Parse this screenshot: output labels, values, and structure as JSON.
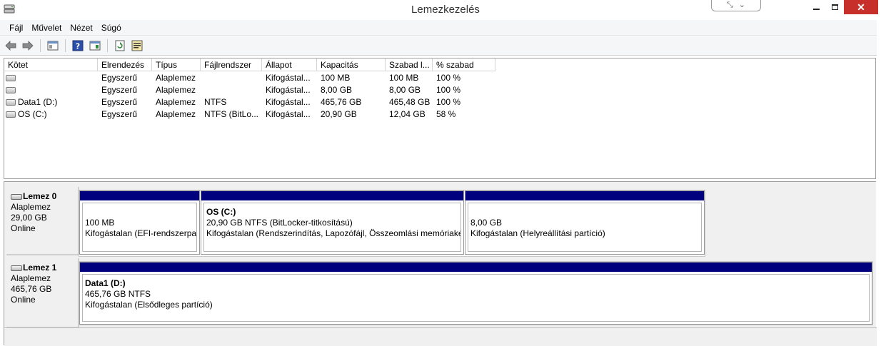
{
  "window": {
    "title": "Lemezkezelés",
    "close_glyph": "✕",
    "snap_glyphs": [
      "⤡",
      "⌄"
    ]
  },
  "menu": [
    "Fájl",
    "Művelet",
    "Nézet",
    "Súgó"
  ],
  "toolbar": {
    "icons": [
      "back-arrow-icon",
      "forward-arrow-icon",
      "show-hide-console-tree-icon",
      "help-icon",
      "show-hide-action-pane-icon",
      "refresh-icon",
      "properties-icon"
    ]
  },
  "volume_list": {
    "columns": [
      "Kötet",
      "Elrendezés",
      "Típus",
      "Fájlrendszer",
      "Állapot",
      "Kapacitás",
      "Szabad l...",
      "% szabad"
    ],
    "rows": [
      [
        "",
        "Egyszerű",
        "Alaplemez",
        "",
        "Kifogástal...",
        "100 MB",
        "100 MB",
        "100 %"
      ],
      [
        "",
        "Egyszerű",
        "Alaplemez",
        "",
        "Kifogástal...",
        "8,00 GB",
        "8,00 GB",
        "100 %"
      ],
      [
        "Data1 (D:)",
        "Egyszerű",
        "Alaplemez",
        "NTFS",
        "Kifogástal...",
        "465,76 GB",
        "465,48 GB",
        "100 %"
      ],
      [
        "OS (C:)",
        "Egyszerű",
        "Alaplemez",
        "NTFS (BitLo...",
        "Kifogástal...",
        "20,90 GB",
        "12,04 GB",
        "58 %"
      ]
    ]
  },
  "disks": [
    {
      "name": "Lemez 0",
      "type": "Alaplemez",
      "size": "29,00 GB",
      "status": "Online",
      "partitions": [
        {
          "name": "",
          "line1": "100 MB",
          "line2": "Kifogástalan (EFI-rendszerpart"
        },
        {
          "name": "OS  (C:)",
          "line1": "20,90 GB NTFS (BitLocker-titkosítású)",
          "line2": "Kifogástalan (Rendszerindítás, Lapozófájl, Összeomlási memóriakép"
        },
        {
          "name": "",
          "line1": "8,00 GB",
          "line2": "Kifogástalan (Helyreállítási partíció)"
        }
      ]
    },
    {
      "name": "Lemez 1",
      "type": "Alaplemez",
      "size": "465,76 GB",
      "status": "Online",
      "partitions": [
        {
          "name": "Data1  (D:)",
          "line1": "465,76 GB NTFS",
          "line2": "Kifogástalan (Elsődleges partíció)"
        }
      ]
    }
  ],
  "colors": {
    "partition_stripe": "#00007f",
    "close_button": "#c7302a"
  }
}
